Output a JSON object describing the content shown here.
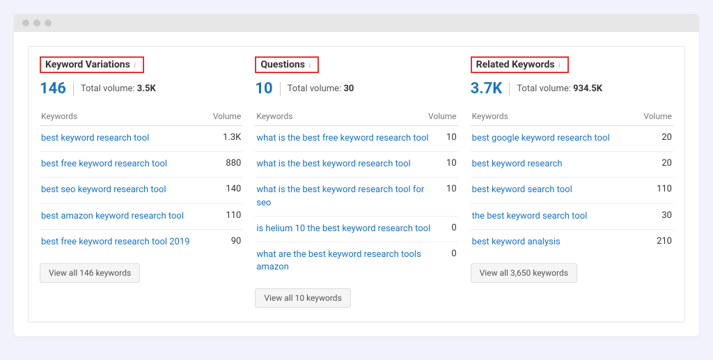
{
  "col_keywords": "Keywords",
  "col_volume": "Volume",
  "tv_label": "Total volume:",
  "panels": [
    {
      "title": "Keyword Variations",
      "count": "146",
      "total_volume": "3.5K",
      "rows": [
        {
          "kw": "best keyword research tool",
          "vol": "1.3K"
        },
        {
          "kw": "best free keyword research tool",
          "vol": "880"
        },
        {
          "kw": "best seo keyword research tool",
          "vol": "140"
        },
        {
          "kw": "best amazon keyword research tool",
          "vol": "110"
        },
        {
          "kw": "best free keyword research tool 2019",
          "vol": "90"
        }
      ],
      "view_all": "View all 146 keywords"
    },
    {
      "title": "Questions",
      "count": "10",
      "total_volume": "30",
      "rows": [
        {
          "kw": "what is the best free keyword research tool",
          "vol": "10"
        },
        {
          "kw": "what is the best keyword research tool",
          "vol": "10"
        },
        {
          "kw": "what is the best keyword research tool for seo",
          "vol": "10"
        },
        {
          "kw": "is helium 10 the best keyword research tool",
          "vol": "0"
        },
        {
          "kw": "what are the best keyword research tools amazon",
          "vol": "0"
        }
      ],
      "view_all": "View all 10 keywords"
    },
    {
      "title": "Related Keywords",
      "count": "3.7K",
      "total_volume": "934.5K",
      "rows": [
        {
          "kw": "best google keyword research tool",
          "vol": "20"
        },
        {
          "kw": "best keyword research",
          "vol": "20"
        },
        {
          "kw": "best keyword search tool",
          "vol": "110"
        },
        {
          "kw": "the best keyword search tool",
          "vol": "30"
        },
        {
          "kw": "best keyword analysis",
          "vol": "210"
        }
      ],
      "view_all": "View all 3,650 keywords"
    }
  ]
}
